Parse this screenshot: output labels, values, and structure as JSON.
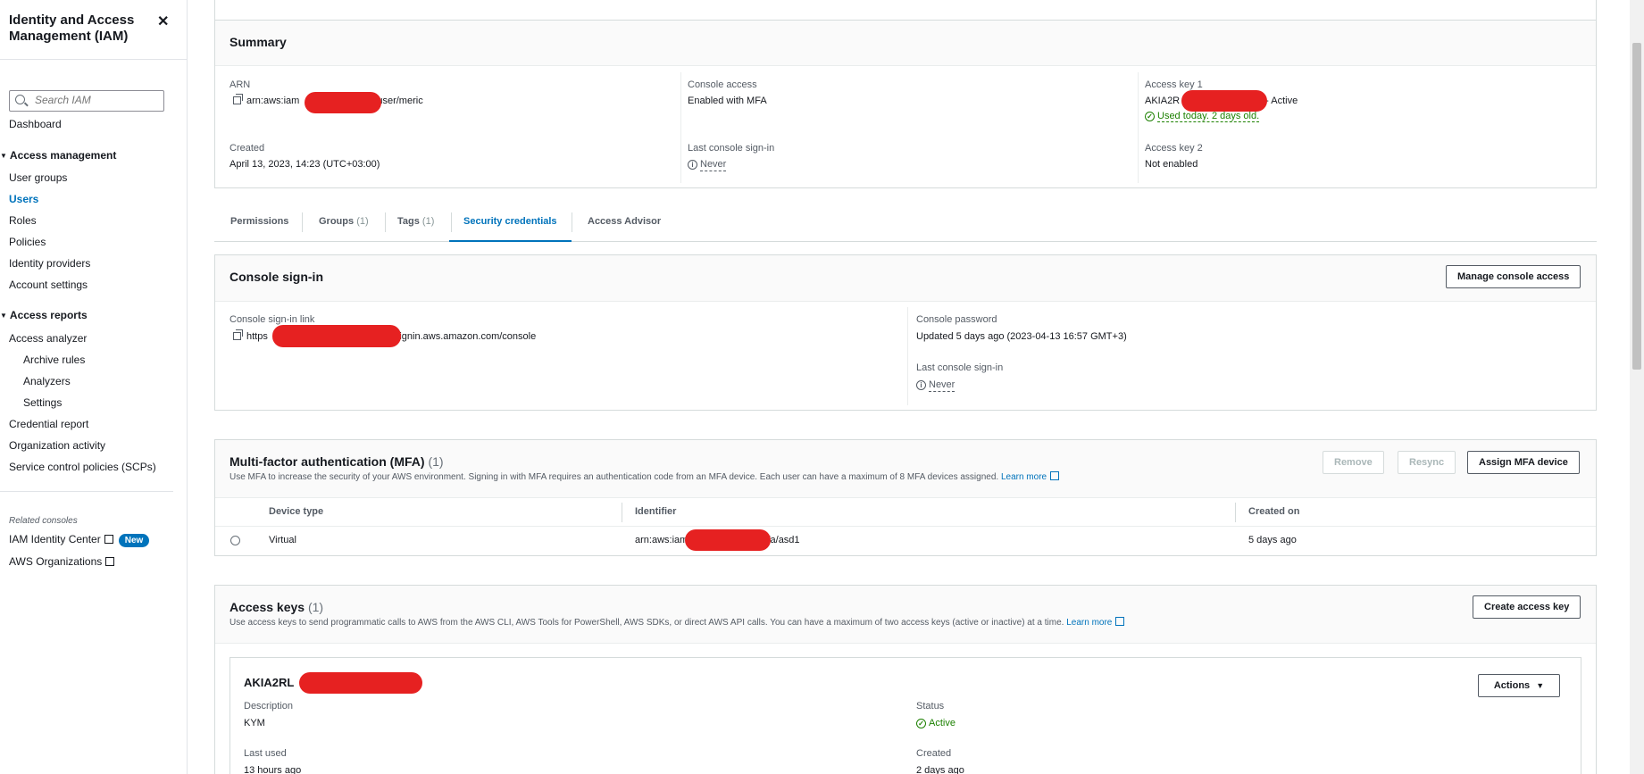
{
  "sidebar": {
    "title": "Identity and Access Management (IAM)",
    "search_placeholder": "Search IAM",
    "dashboard": "Dashboard",
    "access_management": {
      "label": "Access management",
      "items": [
        "User groups",
        "Users",
        "Roles",
        "Policies",
        "Identity providers",
        "Account settings"
      ]
    },
    "access_reports": {
      "label": "Access reports",
      "items": [
        "Access analyzer",
        "Archive rules",
        "Analyzers",
        "Settings",
        "Credential report",
        "Organization activity",
        "Service control policies (SCPs)"
      ]
    },
    "related_label": "Related consoles",
    "related": [
      {
        "label": "IAM Identity Center",
        "badge": "New"
      },
      {
        "label": "AWS Organizations"
      }
    ]
  },
  "summary": {
    "title": "Summary",
    "arn_label": "ARN",
    "arn_prefix": "arn:aws:iam",
    "arn_suffix": ":user/meric",
    "created_label": "Created",
    "created_value": "April 13, 2023, 14:23 (UTC+03:00)",
    "console_access_label": "Console access",
    "console_access_value": "Enabled with MFA",
    "last_signin_label": "Last console sign-in",
    "last_signin_value": "Never",
    "key1_label": "Access key 1",
    "key1_prefix": "AKIA2R",
    "key1_status": "- Active",
    "key1_used": "Used today. 2 days old.",
    "key2_label": "Access key 2",
    "key2_value": "Not enabled"
  },
  "tabs": [
    {
      "label": "Permissions",
      "count": ""
    },
    {
      "label": "Groups",
      "count": "(1)"
    },
    {
      "label": "Tags",
      "count": "(1)"
    },
    {
      "label": "Security credentials",
      "count": ""
    },
    {
      "label": "Access Advisor",
      "count": ""
    }
  ],
  "console_signin": {
    "title": "Console sign-in",
    "manage_button": "Manage console access",
    "link_label": "Console sign-in link",
    "link_prefix": "https",
    "link_suffix": "signin.aws.amazon.com/console",
    "password_label": "Console password",
    "password_value": "Updated 5 days ago (2023-04-13 16:57 GMT+3)",
    "last_signin_label": "Last console sign-in",
    "last_signin_value": "Never"
  },
  "mfa": {
    "title": "Multi-factor authentication (MFA)",
    "count": "(1)",
    "description": "Use MFA to increase the security of your AWS environment. Signing in with MFA requires an authentication code from an MFA device. Each user can have a maximum of 8 MFA devices assigned.",
    "learn_more": "Learn more",
    "remove_button": "Remove",
    "resync_button": "Resync",
    "assign_button": "Assign MFA device",
    "columns": [
      "Device type",
      "Identifier",
      "Created on"
    ],
    "rows": [
      {
        "device_type": "Virtual",
        "identifier_prefix": "arn:aws:iam",
        "identifier_suffix": "mfa/asd1",
        "created_on": "5 days ago"
      }
    ]
  },
  "access_keys": {
    "title": "Access keys",
    "count": "(1)",
    "description": "Use access keys to send programmatic calls to AWS from the AWS CLI, AWS Tools for PowerShell, AWS SDKs, or direct AWS API calls. You can have a maximum of two access keys (active or inactive) at a time.",
    "learn_more": "Learn more",
    "create_button": "Create access key",
    "key": {
      "id_prefix": "AKIA2RL",
      "actions_button": "Actions",
      "description_label": "Description",
      "description_value": "KYM",
      "status_label": "Status",
      "status_value": "Active",
      "last_used_label": "Last used",
      "last_used_value": "13 hours ago",
      "created_label": "Created",
      "created_value": "2 days ago"
    }
  },
  "colors": {
    "link": "#0073bb",
    "success": "#1d8102",
    "redaction": "#e62121"
  }
}
